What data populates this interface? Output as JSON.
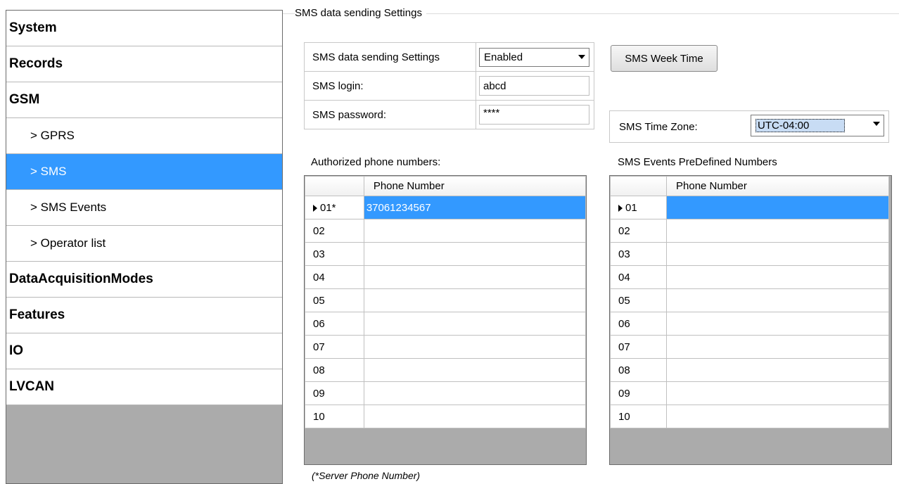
{
  "sidebar": {
    "items": [
      {
        "label": "System"
      },
      {
        "label": "Records"
      },
      {
        "label": "GSM"
      },
      {
        "label": "> GPRS"
      },
      {
        "label": "> SMS"
      },
      {
        "label": "> SMS Events"
      },
      {
        "label": "> Operator list"
      },
      {
        "label": "DataAcquisitionModes"
      },
      {
        "label": "Features"
      },
      {
        "label": "IO"
      },
      {
        "label": "LVCAN"
      }
    ],
    "selected": "> SMS"
  },
  "group": {
    "title": "SMS data sending Settings"
  },
  "settings": {
    "sending_label": "SMS data sending Settings",
    "sending_value": "Enabled",
    "login_label": "SMS login:",
    "login_value": "abcd",
    "password_label": "SMS password:",
    "password_value": "****",
    "week_time_button": "SMS Week Time",
    "timezone_label": "SMS Time Zone:",
    "timezone_value": "UTC-04:00"
  },
  "authorized": {
    "title": "Authorized phone numbers:",
    "column": "Phone Number",
    "rows": [
      {
        "num": "01*",
        "value": "37061234567"
      },
      {
        "num": "02",
        "value": ""
      },
      {
        "num": "03",
        "value": ""
      },
      {
        "num": "04",
        "value": ""
      },
      {
        "num": "05",
        "value": ""
      },
      {
        "num": "06",
        "value": ""
      },
      {
        "num": "07",
        "value": ""
      },
      {
        "num": "08",
        "value": ""
      },
      {
        "num": "09",
        "value": ""
      },
      {
        "num": "10",
        "value": ""
      }
    ]
  },
  "predefined": {
    "title": "SMS Events PreDefined Numbers",
    "column": "Phone Number",
    "rows": [
      {
        "num": "01",
        "value": ""
      },
      {
        "num": "02",
        "value": ""
      },
      {
        "num": "03",
        "value": ""
      },
      {
        "num": "04",
        "value": ""
      },
      {
        "num": "05",
        "value": ""
      },
      {
        "num": "06",
        "value": ""
      },
      {
        "num": "07",
        "value": ""
      },
      {
        "num": "08",
        "value": ""
      },
      {
        "num": "09",
        "value": ""
      },
      {
        "num": "10",
        "value": ""
      }
    ]
  },
  "footnote": "(*Server Phone Number)",
  "colors": {
    "selection": "#3399ff",
    "sidebar_empty": "#ababab"
  }
}
